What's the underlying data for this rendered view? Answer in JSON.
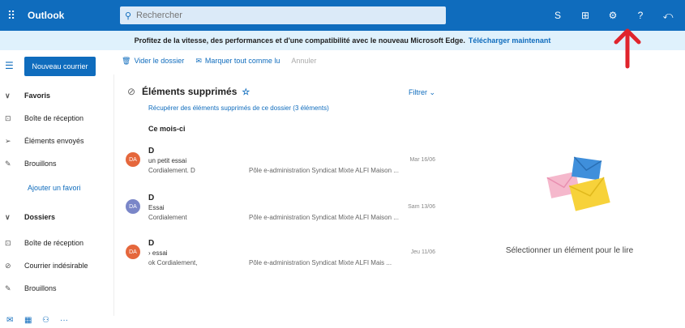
{
  "topbar": {
    "app_name": "Outlook",
    "search_placeholder": "Rechercher",
    "icons": [
      "skype-icon",
      "calendar-icon",
      "settings-icon",
      "help-icon",
      "feedback-icon"
    ]
  },
  "banner": {
    "text": "Profitez de la vitesse, des performances et d'une compatibilité avec le nouveau Microsoft Edge.",
    "link": "Télécharger maintenant"
  },
  "sidebar": {
    "new_mail": "Nouveau courrier",
    "favorites_label": "Favoris",
    "favorites": [
      {
        "label": "Boîte de réception"
      },
      {
        "label": "Éléments envoyés"
      },
      {
        "label": "Brouillons"
      }
    ],
    "add_favorite": "Ajouter un favori",
    "folders_label": "Dossiers",
    "folders": [
      {
        "label": "Boîte de réception"
      },
      {
        "label": "Courrier indésirable"
      },
      {
        "label": "Brouillons"
      }
    ]
  },
  "toolbar": {
    "empty_folder": "Vider le dossier",
    "mark_all_read": "Marquer tout comme lu",
    "undo": "Annuler"
  },
  "list": {
    "folder_title": "Éléments supprimés",
    "filter": "Filtrer",
    "recover_link": "Récupérer des éléments supprimés de ce dossier (3 éléments)",
    "group_label": "Ce mois-ci",
    "messages": [
      {
        "initials": "DA",
        "color": "#e5673c",
        "sender": "D",
        "subject": "un petit essai",
        "date": "Mar 16/06",
        "preview": "Cordialement. D",
        "preview2": "Pôle e-administration Syndicat Mixte ALFI Maison ..."
      },
      {
        "initials": "DA",
        "color": "#7a86c8",
        "sender": "D",
        "subject": "Essai",
        "date": "Sam 13/06",
        "preview": "Cordialement",
        "preview2": "Pôle e-administration Syndicat Mixte ALFI Maison ..."
      },
      {
        "initials": "DA",
        "color": "#e5673c",
        "sender": "D",
        "subject": "essai",
        "date": "Jeu 11/06",
        "preview": "ok Cordialement,",
        "preview2": "Pôle e-administration Syndicat Mixte ALFI Mais ..."
      }
    ]
  },
  "reading_pane": {
    "empty_text": "Sélectionner un élément pour le lire"
  },
  "colors": {
    "brand": "#0f6cbd",
    "banner_bg": "#dff1fc",
    "annotation_arrow": "#e0242c"
  }
}
